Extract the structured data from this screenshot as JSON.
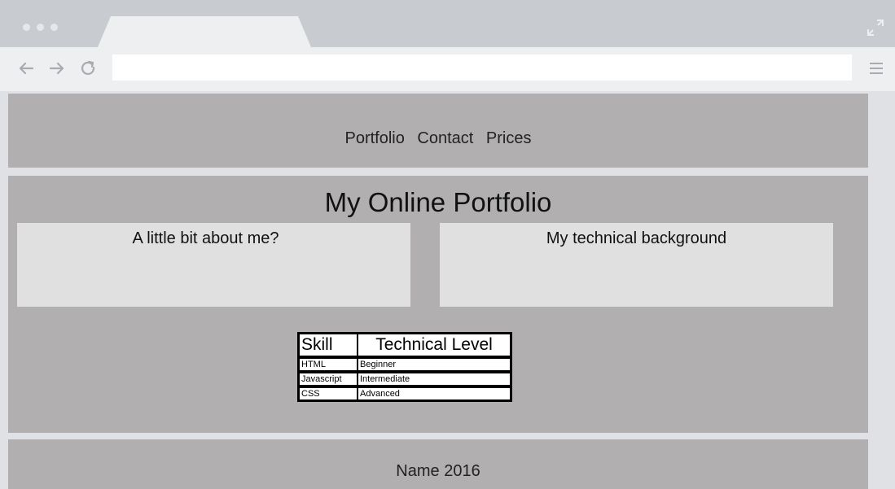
{
  "browser": {
    "address": "",
    "icons": {
      "back": "arrow-left-icon",
      "forward": "arrow-right-icon",
      "reload": "reload-icon",
      "menu": "hamburger-menu-icon",
      "expand": "expand-icon"
    }
  },
  "header": {
    "nav": [
      "Portfolio",
      "Contact",
      "Prices"
    ]
  },
  "main": {
    "title": "My Online Portfolio",
    "about_heading": "A little bit about me?",
    "tech_heading": "My technical background",
    "table": {
      "headers": [
        "Skill",
        "Technical Level"
      ],
      "rows": [
        [
          "HTML",
          "Beginner"
        ],
        [
          "Javascript",
          "Intermediate"
        ],
        [
          "CSS",
          "Advanced"
        ]
      ]
    }
  },
  "footer": {
    "text": "Name 2016"
  },
  "colors": {
    "section_bg": "#b1afb0",
    "card_bg": "#e0e0e0",
    "chrome_bg": "#c8cbcf",
    "toolbar_bg": "#eeeff1"
  }
}
